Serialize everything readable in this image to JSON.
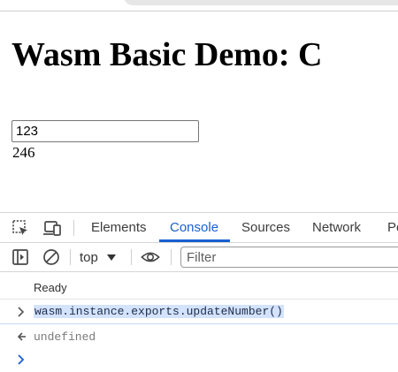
{
  "page": {
    "heading": "Wasm Basic Demo: C",
    "input_value": "123",
    "result": "246"
  },
  "devtools": {
    "tabs": [
      {
        "label": "Elements",
        "active": false
      },
      {
        "label": "Console",
        "active": true
      },
      {
        "label": "Sources",
        "active": false
      },
      {
        "label": "Network",
        "active": false
      },
      {
        "label": "Pe",
        "active": false
      }
    ],
    "toolbar": {
      "context": "top",
      "filter_placeholder": "Filter"
    },
    "console": {
      "messages": [
        {
          "kind": "log",
          "text": "Ready"
        },
        {
          "kind": "input",
          "text": "wasm.instance.exports.updateNumber()"
        },
        {
          "kind": "result",
          "text": "undefined"
        }
      ]
    },
    "accent_color": "#1a5fd0"
  },
  "icons": {
    "inspect": "inspect-element-icon",
    "device": "device-toolbar-icon",
    "sidebar": "show-sidebar-icon",
    "clear": "clear-console-icon",
    "context_dropdown": "caret-down-icon",
    "live_expression": "eye-icon",
    "expand": "chevron-right-icon",
    "return": "return-arrow-icon",
    "prompt": "prompt-chevron-icon"
  }
}
